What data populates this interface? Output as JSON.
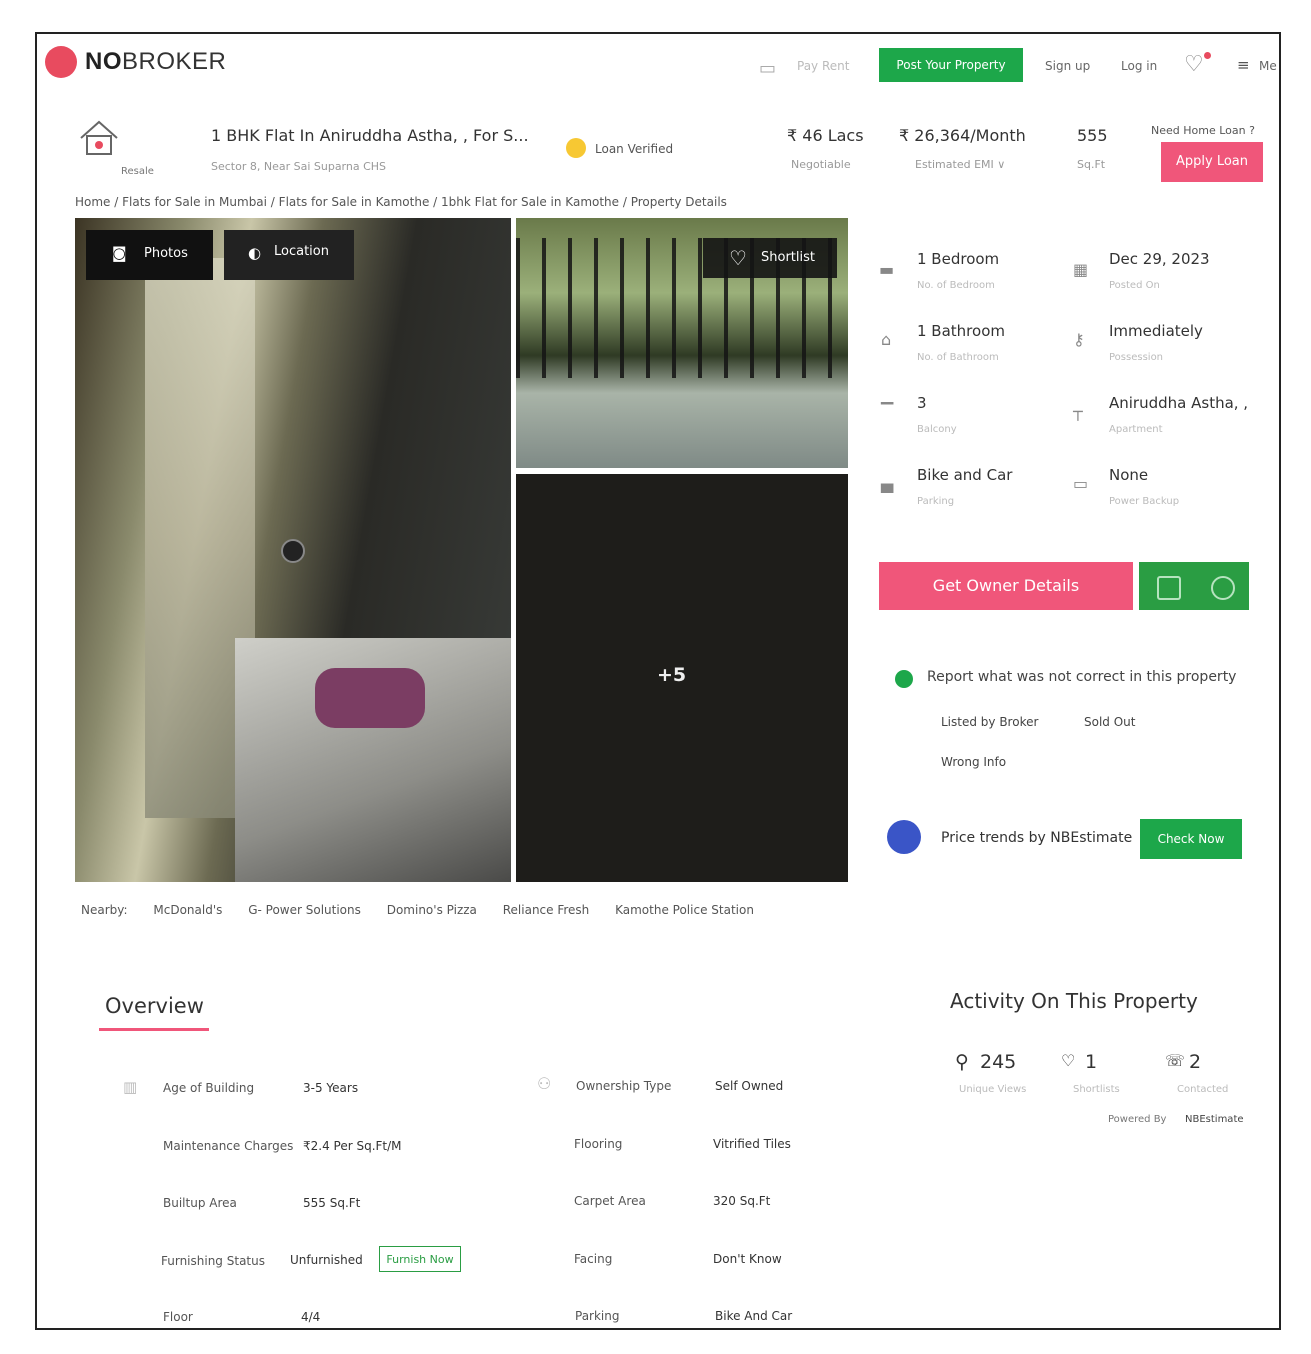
{
  "header": {
    "brand_bold": "NO",
    "brand_rest": "BROKER",
    "pay_rent": "Pay Rent",
    "post_property": "Post Your Property",
    "sign_up": "Sign up",
    "log_in": "Log in",
    "menu": "Me"
  },
  "listing": {
    "type_label": "Resale",
    "title": "1 BHK Flat In Aniruddha Astha, , For S...",
    "address": "Sector 8, Near Sai Suparna CHS",
    "loan_verified": "Loan Verified",
    "price": "₹ 46 Lacs",
    "price_note": "Negotiable",
    "emi": "₹ 26,364/Month",
    "emi_note": "Estimated EMI ∨",
    "area": "555",
    "area_unit": "Sq.Ft",
    "home_loan_q": "Need Home Loan ?",
    "apply_loan": "Apply Loan"
  },
  "breadcrumb": "Home / Flats for Sale in Mumbai / Flats for Sale in Kamothe / 1bhk Flat for Sale in Kamothe / Property Details",
  "gallery": {
    "photos_btn": "Photos",
    "location_btn": "Location",
    "shortlist_btn": "Shortlist",
    "more_count": "+5"
  },
  "nearby": {
    "label": "Nearby:",
    "places": [
      "McDonald's",
      "G- Power Solutions",
      "Domino's Pizza",
      "Reliance Fresh",
      "Kamothe Police Station"
    ]
  },
  "details": [
    {
      "value": "1 Bedroom",
      "label": "No. of Bedroom",
      "icon": "bed-icon"
    },
    {
      "value": "Dec 29, 2023",
      "label": "Posted On",
      "icon": "calendar-icon"
    },
    {
      "value": "1 Bathroom",
      "label": "No. of Bathroom",
      "icon": "bathtub-icon"
    },
    {
      "value": "Immediately",
      "label": "Possession",
      "icon": "key-icon"
    },
    {
      "value": "3",
      "label": "Balcony",
      "icon": "balcony-icon"
    },
    {
      "value": "Aniruddha Astha, ,",
      "label": "Apartment",
      "icon": "building-icon"
    },
    {
      "value": "Bike and Car",
      "label": "Parking",
      "icon": "car-icon"
    },
    {
      "value": "None",
      "label": "Power Backup",
      "icon": "battery-icon"
    }
  ],
  "actions": {
    "owner_details": "Get Owner Details",
    "report": "Report what was not correct in this property",
    "report_options": [
      "Listed by Broker",
      "Sold Out",
      "Wrong Info"
    ],
    "price_trends": "Price trends by NBEstimate",
    "check_now": "Check Now"
  },
  "overview": {
    "title": "Overview",
    "rows": [
      {
        "label": "Age of Building",
        "value": "3-5 Years",
        "label2": "Ownership Type",
        "value2": "Self Owned"
      },
      {
        "label": "Maintenance Charges",
        "value": "₹2.4 Per Sq.Ft/M",
        "label2": "Flooring",
        "value2": "Vitrified Tiles"
      },
      {
        "label": "Builtup Area",
        "value": "555 Sq.Ft",
        "label2": "Carpet Area",
        "value2": "320 Sq.Ft"
      },
      {
        "label": "Furnishing Status",
        "value": "Unfurnished",
        "label2": "Facing",
        "value2": "Don't Know"
      },
      {
        "label": "Floor",
        "value": "4/4",
        "label2": "Parking",
        "value2": "Bike And Car"
      }
    ],
    "furnish_now": "Furnish Now"
  },
  "activity": {
    "title": "Activity On This Property",
    "views": "245",
    "views_label": "Unique Views",
    "shortlists": "1",
    "shortlists_label": "Shortlists",
    "contacted": "2",
    "contacted_label": "Contacted",
    "powered_by": "Powered By",
    "powered_name": "NBEstimate"
  },
  "colors": {
    "brand": "#e84b5f",
    "green": "#1da74a",
    "pink_button": "#f0567a"
  }
}
